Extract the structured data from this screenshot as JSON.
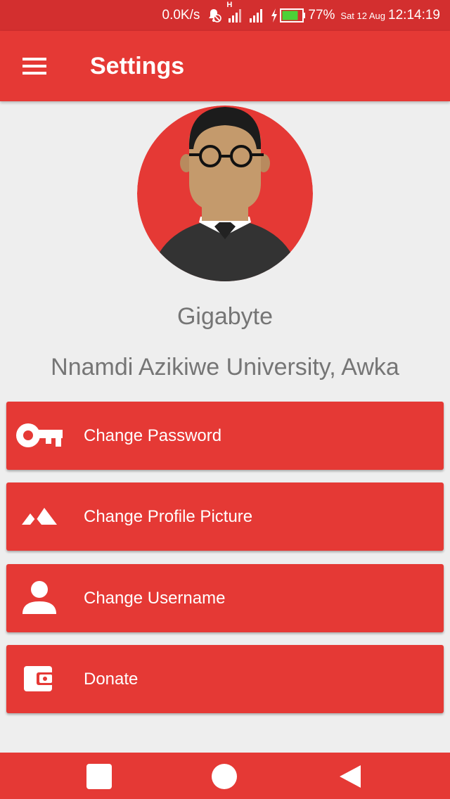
{
  "status_bar": {
    "net_speed": "0.0K/s",
    "network_type": "H",
    "battery": "77%",
    "date": "Sat 12 Aug",
    "time": "12:14:19",
    "battery_color": "#4cd137",
    "icons": [
      "alarm-off-icon",
      "signal-icon",
      "signal-icon",
      "charging-icon",
      "battery-icon"
    ]
  },
  "app_bar": {
    "title": "Settings",
    "menu_icon": "hamburger-menu-icon"
  },
  "profile": {
    "name": "Gigabyte",
    "school": "Nnamdi Azikiwe University, Awka"
  },
  "options": [
    {
      "label": "Change Password",
      "icon": "key-icon"
    },
    {
      "label": "Change Profile Picture",
      "icon": "landscape-icon"
    },
    {
      "label": "Change Username",
      "icon": "person-icon"
    },
    {
      "label": "Donate",
      "icon": "wallet-icon"
    }
  ],
  "nav_bar": {
    "buttons": [
      "recents-square-icon",
      "home-circle-icon",
      "back-triangle-icon"
    ]
  },
  "colors": {
    "primary": "#e53935",
    "primary_dark": "#d32f2f",
    "background": "#eeeeee",
    "text_secondary": "#757575"
  }
}
